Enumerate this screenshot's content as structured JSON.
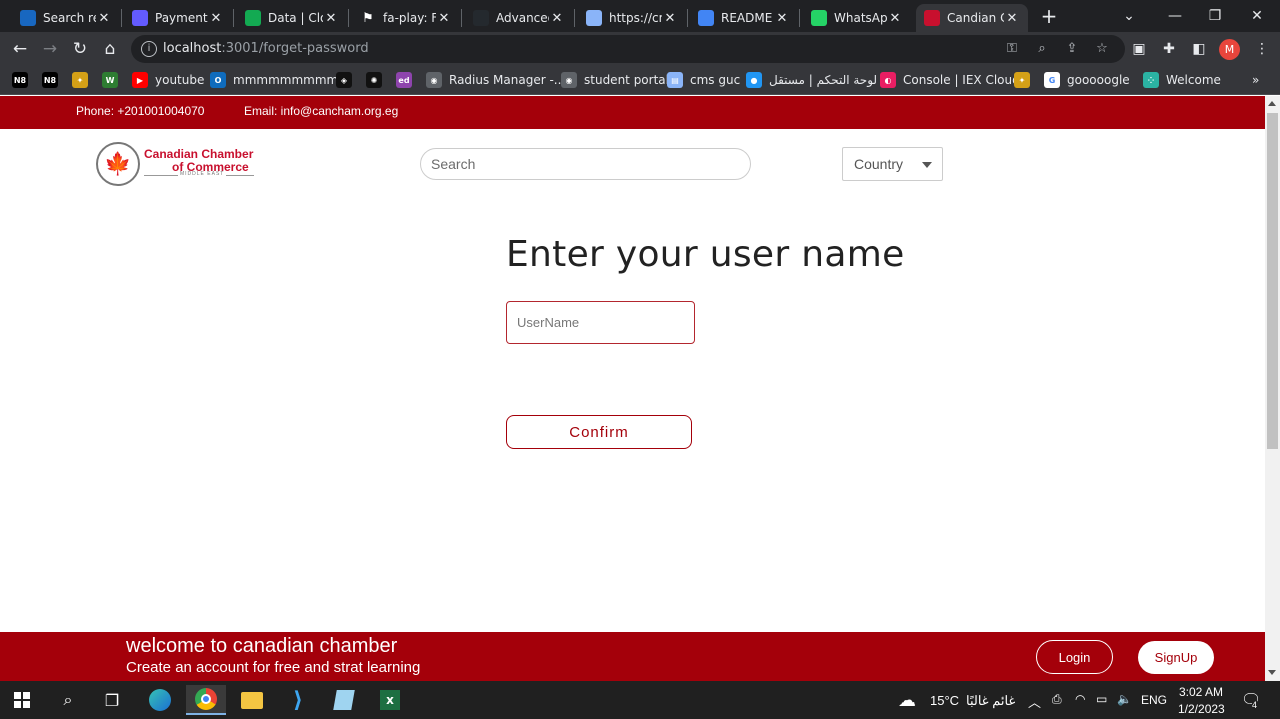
{
  "browser": {
    "tabs": [
      {
        "title": "Search res",
        "icon": "vuetify-icon",
        "color": "#1867c0"
      },
      {
        "title": "Payments",
        "icon": "stripe-icon",
        "color": "#635bff"
      },
      {
        "title": "Data | Clou",
        "icon": "mongodb-icon",
        "color": "#13aa52"
      },
      {
        "title": "fa-play: Fo",
        "icon": "flag-icon",
        "color": "#ffffff"
      },
      {
        "title": "Advanced",
        "icon": "github-icon",
        "color": "#24292e"
      },
      {
        "title": "https://cm",
        "icon": "document-icon",
        "color": "#8ab4f8"
      },
      {
        "title": "README F",
        "icon": "google-icon",
        "color": "#4285f4"
      },
      {
        "title": "WhatsApp",
        "icon": "whatsapp-icon",
        "color": "#25d366"
      },
      {
        "title": "Candian C",
        "icon": "canadian-chamber-icon",
        "color": "#c8102e",
        "active": true
      }
    ],
    "url_host": "localhost",
    "url_path": ":3001/forget-password",
    "profile_initial": "M",
    "bookmarks": [
      {
        "label": "",
        "icon": "nh-icon"
      },
      {
        "label": "",
        "icon": "nh-icon"
      },
      {
        "label": "",
        "icon": "bookmark-icon"
      },
      {
        "label": "",
        "icon": "w-icon"
      },
      {
        "label": "youtube",
        "icon": "youtube-icon"
      },
      {
        "label": "mmmmmmmmm",
        "icon": "outlook-icon"
      },
      {
        "label": "",
        "icon": "codepen-icon"
      },
      {
        "label": "",
        "icon": "chatgpt-icon"
      },
      {
        "label": "",
        "icon": "ed-icon"
      },
      {
        "label": "Radius Manager -...",
        "icon": "globe-icon"
      },
      {
        "label": "student portal",
        "icon": "globe-icon"
      },
      {
        "label": "cms guc",
        "icon": "document-icon"
      },
      {
        "label": "لوحة التحكم | مستقل",
        "icon": "mostaql-icon"
      },
      {
        "label": "Console | IEX Cloud",
        "icon": "iex-icon"
      },
      {
        "label": "",
        "icon": "bookmark-icon"
      },
      {
        "label": "gooooogle",
        "icon": "google-icon"
      },
      {
        "label": "Welcome",
        "icon": "dots-icon"
      }
    ]
  },
  "site": {
    "phone": "Phone: +201001004070",
    "email": "Email: info@cancham.org.eg",
    "logo_line1": "Canadian Chamber",
    "logo_line2": "of Commerce",
    "logo_line3": "MIDDLE EAST",
    "search_placeholder": "Search",
    "country_label": "Country",
    "heading": "Enter your user name",
    "username_placeholder": "UserName",
    "confirm_label": "Confirm",
    "footer_title": "welcome to canadian chamber",
    "footer_subtitle": "Create an account for free and strat learning",
    "login_label": "Login",
    "signup_label": "SignUp",
    "brand_red": "#a4000a"
  },
  "taskbar": {
    "weather": "15°C",
    "weather_desc": "غائم غالبًا",
    "lang": "ENG",
    "time": "3:02 AM",
    "date": "1/2/2023",
    "notifications": "4"
  }
}
